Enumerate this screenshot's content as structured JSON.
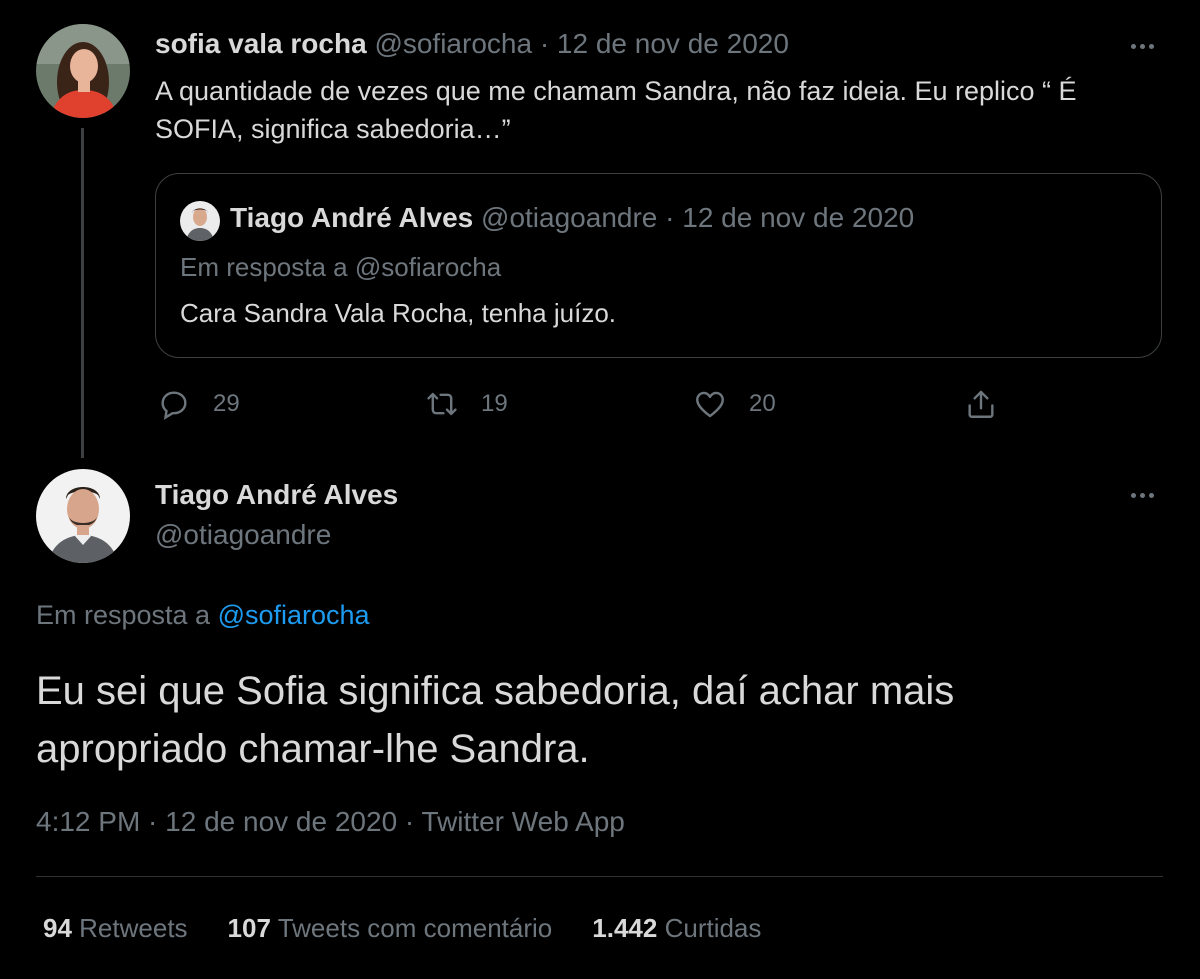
{
  "quoted_thread_tweet": {
    "author_name": "sofia vala rocha",
    "author_handle": "@sofiarocha",
    "date": "· 12 de nov de 2020",
    "text": "A quantidade de vezes que me chamam Sandra, não faz ideia. Eu replico “ É SOFIA, significa sabedoria…”",
    "quote": {
      "author_name": "Tiago André Alves",
      "author_handle": "@otiagoandre",
      "date": "· 12 de nov de 2020",
      "reply_context": "Em resposta a @sofiarocha",
      "text": "Cara Sandra Vala Rocha, tenha juízo."
    },
    "actions": {
      "reply_count": "29",
      "retweet_count": "19",
      "like_count": "20"
    }
  },
  "main_tweet": {
    "author_name": "Tiago André Alves",
    "author_handle": "@otiagoandre",
    "reply_prefix": "Em resposta a",
    "reply_mention": "@sofiarocha",
    "text": "Eu sei que Sofia significa sabedoria, daí achar mais apropriado chamar-lhe Sandra.",
    "meta": "4:12 PM · 12 de nov de 2020 · Twitter Web App",
    "stats": {
      "retweets_count": "94",
      "retweets_label": "Retweets",
      "quotes_count": "107",
      "quotes_label": "Tweets com comentário",
      "likes_count": "1.442",
      "likes_label": "Curtidas"
    }
  },
  "icons": {
    "reply": "reply-icon",
    "retweet": "retweet-icon",
    "like": "heart-icon",
    "share": "share-icon",
    "more": "more-icon"
  },
  "colors": {
    "background": "#000000",
    "text": "#d9d9d9",
    "muted": "#6e767d",
    "link": "#1d9bf0",
    "border": "#3d4043"
  }
}
